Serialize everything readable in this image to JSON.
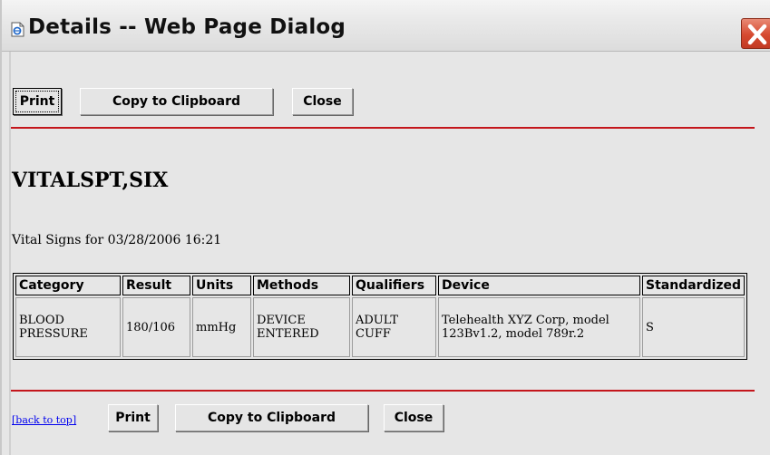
{
  "window": {
    "title": "Details -- Web Page Dialog"
  },
  "toolbar_top": {
    "print_label": "Print",
    "copy_label": "Copy to Clipboard",
    "close_label": "Close"
  },
  "patient": {
    "name": "VITALSPT,SIX"
  },
  "vitals": {
    "caption": "Vital Signs for 03/28/2006 16:21",
    "columns": [
      "Category",
      "Result",
      "Units",
      "Methods",
      "Qualifiers",
      "Device",
      "Standardized"
    ],
    "rows": [
      {
        "category": "BLOOD PRESSURE",
        "result": "180/106",
        "units": "mmHg",
        "methods": "DEVICE ENTERED",
        "qualifiers": "ADULT CUFF",
        "device": "Telehealth XYZ Corp, model 123Bv1.2, model 789r.2",
        "standardized": "S"
      }
    ]
  },
  "footer": {
    "back_to_top": "[back to top]",
    "print_label": "Print",
    "copy_label": "Copy to Clipboard",
    "close_label": "Close"
  },
  "colors": {
    "rule": "#c4161c",
    "link": "#0000ee",
    "close_button": "#d6492f"
  }
}
